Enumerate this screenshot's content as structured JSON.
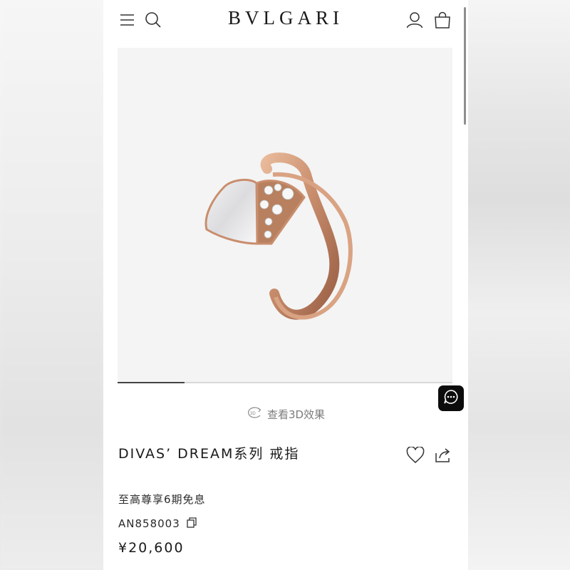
{
  "header": {
    "brand": "BVLGARI",
    "icons": [
      "menu-icon",
      "search-icon",
      "account-icon",
      "shopping-bag-icon"
    ]
  },
  "gallery": {
    "progress": 0.2,
    "view_3d_label": "查看3D效果",
    "view_3d_icon_text": "3D"
  },
  "product": {
    "title": "DIVAS’ DREAM系列 戒指",
    "installment": "至高尊享6期免息",
    "sku": "AN858003",
    "price": "¥20,600"
  },
  "colors": {
    "text": "#1a1a1a",
    "muted": "#7b7b7b",
    "chat_button": "#0c0c0c",
    "rose_gold": "#c98e6d"
  }
}
